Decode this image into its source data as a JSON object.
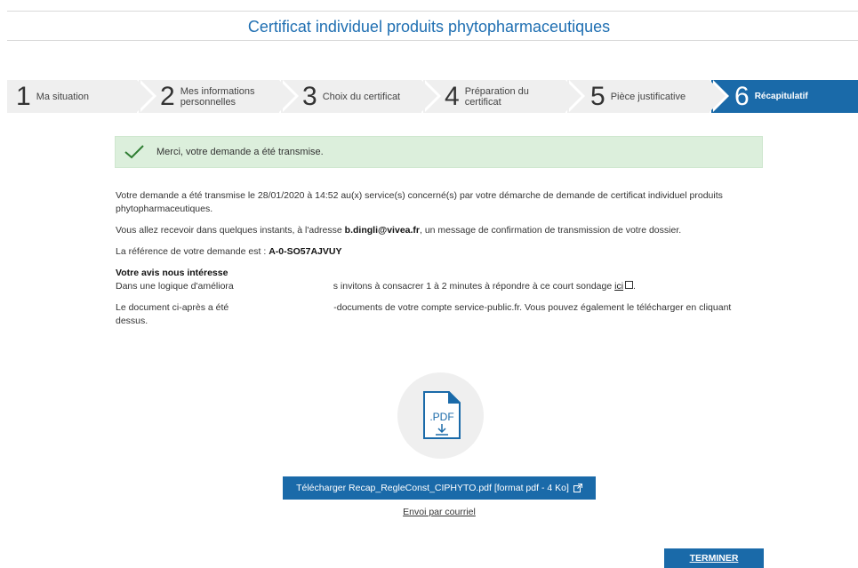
{
  "header": {
    "title": "Certificat individuel produits phytopharmaceutiques"
  },
  "stepper": {
    "steps": [
      {
        "num": "1",
        "label": "Ma situation"
      },
      {
        "num": "2",
        "label": "Mes informations personnelles"
      },
      {
        "num": "3",
        "label": "Choix du certificat"
      },
      {
        "num": "4",
        "label": "Préparation du certificat"
      },
      {
        "num": "5",
        "label": "Pièce justificative"
      },
      {
        "num": "6",
        "label": "Récapitulatif"
      }
    ],
    "active_step": 6
  },
  "alert": {
    "text": "Merci, votre demande a été transmise."
  },
  "content": {
    "p1": "Votre demande a été transmise le 28/01/2020 à 14:52 au(x) service(s) concerné(s) par votre démarche de demande de certificat individuel produits phytopharmaceutiques.",
    "p2_before": "Vous allez recevoir dans quelques instants, à l'adresse ",
    "p2_email": "b.dingli@vivea.fr",
    "p2_after": ", un message de confirmation de transmission de votre dossier.",
    "p3_before": "La référence de votre demande est : ",
    "p3_ref": "A-0-SO57AJVUY",
    "survey_title": "Votre avis nous intéresse",
    "survey_left": "Dans une logique d'améliora",
    "survey_right": "s invitons à consacrer 1 à 2 minutes à répondre à ce court sondage ",
    "survey_link": "ici",
    "survey_end": ".",
    "doc_left": "Le document ci-après a été",
    "doc_right": "-documents de votre compte service-public.fr. Vous pouvez également le télécharger en cliquant",
    "doc_end": "dessus."
  },
  "pdf_icon": {
    "label": ".PDF"
  },
  "actions": {
    "download_label": "Télécharger Recap_RegleConst_CIPHYTO.pdf [format pdf - 4 Ko]",
    "email_label": "Envoi par courriel",
    "finish_label": "TERMINER"
  },
  "colors": {
    "primary": "#1a6aa9",
    "success_bg": "#dcefdc",
    "check": "#2e7d32"
  }
}
